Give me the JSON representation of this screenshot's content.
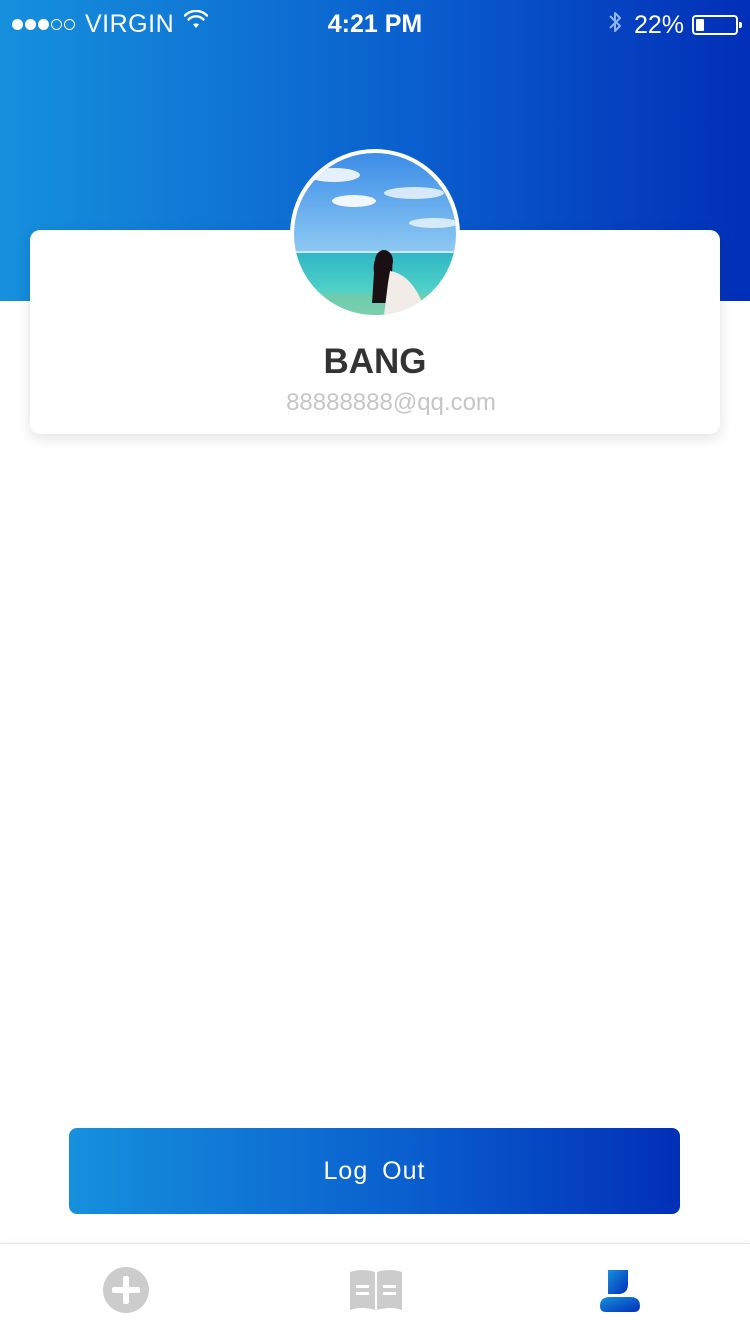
{
  "status_bar": {
    "carrier": "VIRGIN",
    "time": "4:21 PM",
    "battery": "22%",
    "battery_level": 0.22,
    "signal_bars_filled": 3,
    "signal_bars_total": 5
  },
  "profile": {
    "name": "BANG",
    "email": "88888888@qq.com"
  },
  "actions": {
    "logout_label": "Log  Out"
  },
  "tabbar": {
    "items": [
      {
        "icon": "plus-circle-icon",
        "active": false
      },
      {
        "icon": "book-icon",
        "active": false
      },
      {
        "icon": "user-icon",
        "active": true
      }
    ]
  },
  "colors": {
    "gradient_start": "#1690dc",
    "gradient_end": "#022fb8",
    "tab_inactive": "#cccccc",
    "name_text": "#333333",
    "email_text": "#c6c6c6"
  }
}
